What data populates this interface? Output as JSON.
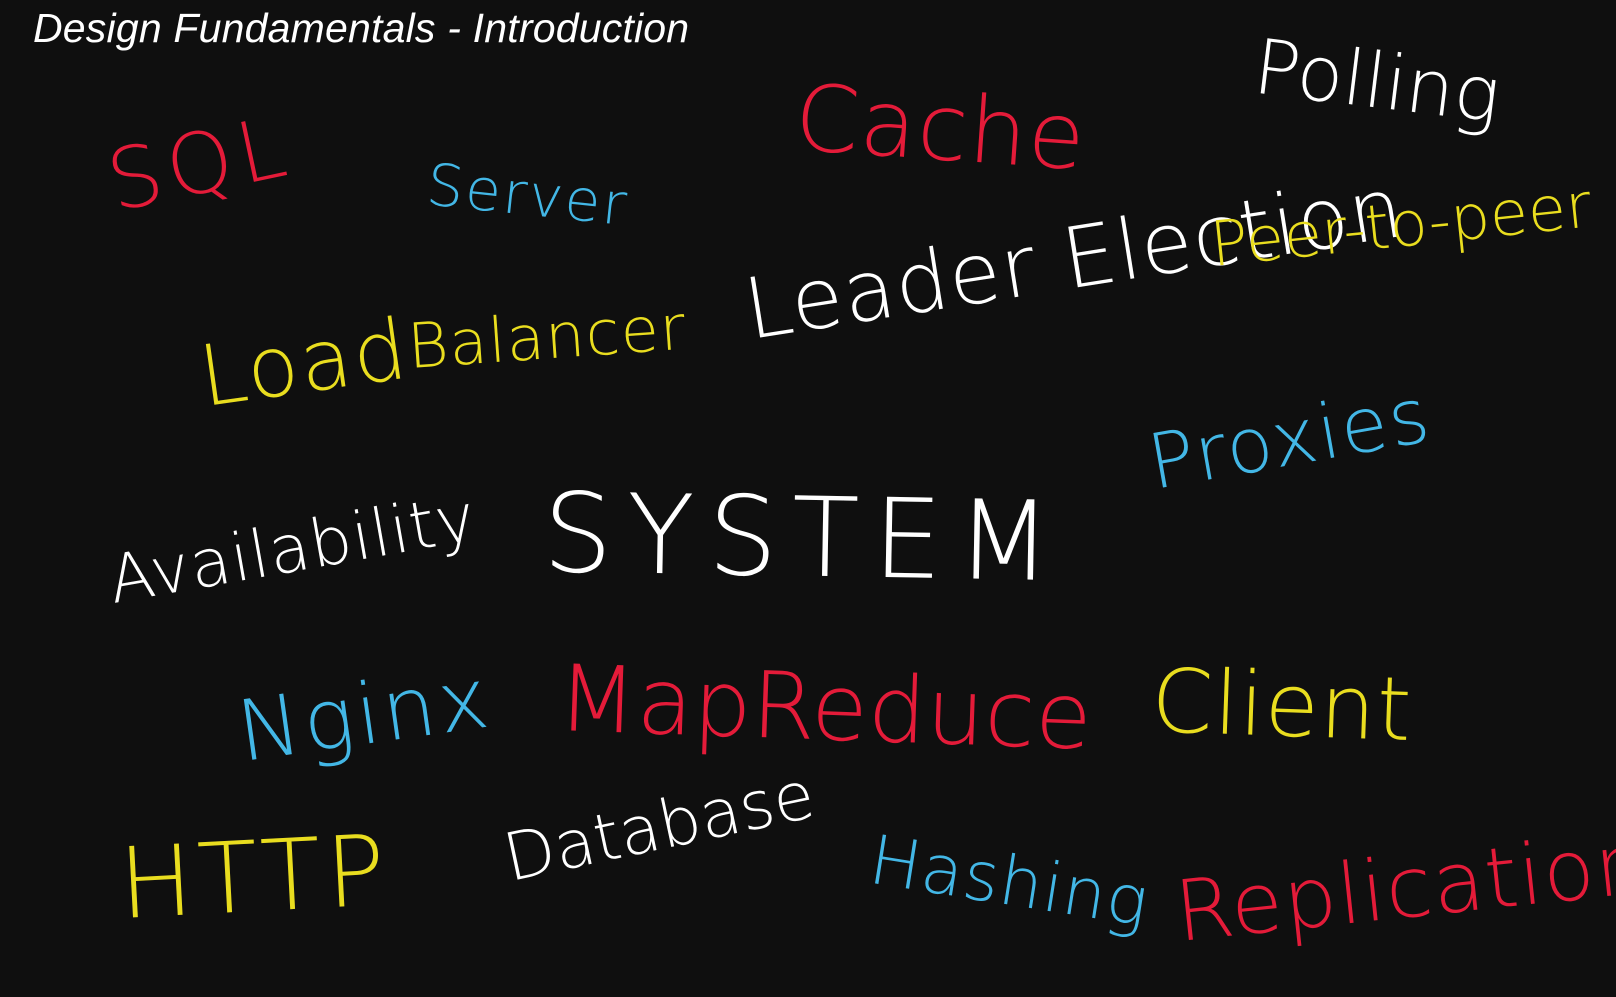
{
  "title": "Design Fundamentals - Introduction",
  "colors": {
    "background": "#0f0f0f",
    "red": "#e41b39",
    "blue": "#43b7e6",
    "yellow": "#e9dd1f",
    "white": "#ffffff"
  },
  "words": {
    "sql": "SQL",
    "server": "Server",
    "cache": "Cache",
    "polling": "Polling",
    "load": "Load",
    "balancer": "Balancer",
    "leader_election": "Leader Election",
    "peer_to_peer": "Peer-to-peer",
    "proxies": "Proxies",
    "availability": "Availability",
    "system": "SYSTEM",
    "nginx": "Nginx",
    "mapreduce": "MapReduce",
    "client": "Client",
    "http": "HTTP",
    "database": "Database",
    "hashing": "Hashing",
    "replication": "Replication"
  }
}
